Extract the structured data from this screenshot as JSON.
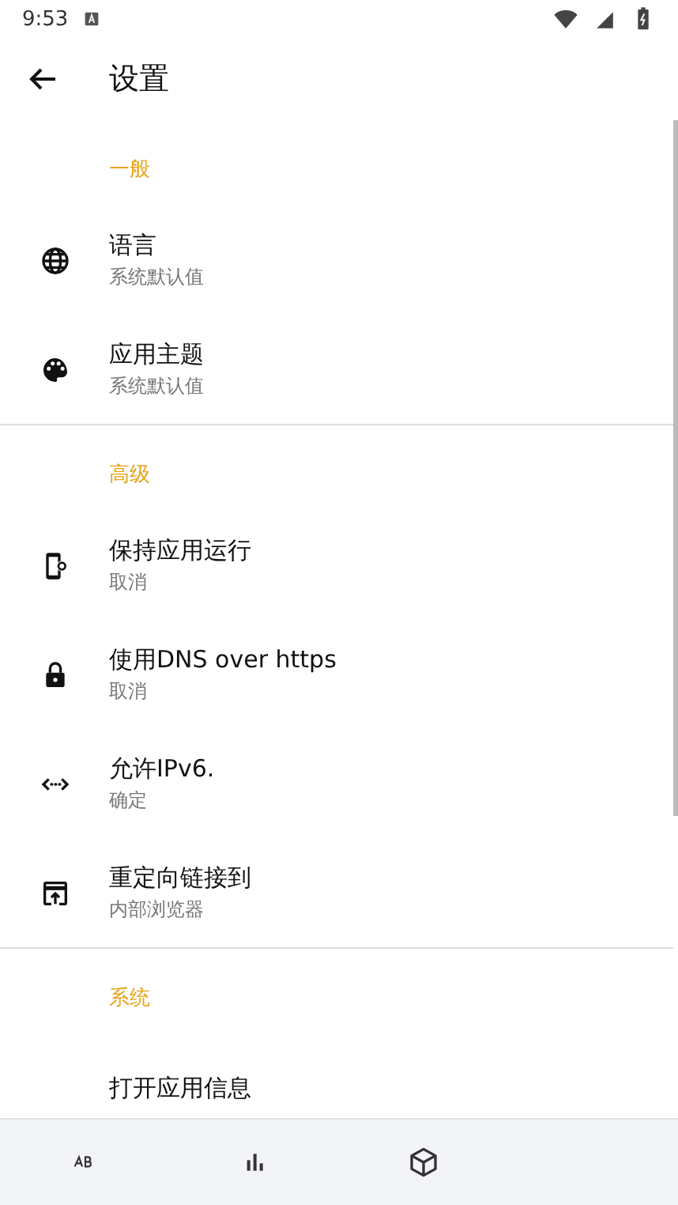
{
  "status_bar": {
    "time": "9:53"
  },
  "toolbar": {
    "title": "设置"
  },
  "sections": [
    {
      "header": "一般",
      "items": [
        {
          "title": "语言",
          "summary": "系统默认值"
        },
        {
          "title": "应用主题",
          "summary": "系统默认值"
        }
      ]
    },
    {
      "header": "高级",
      "items": [
        {
          "title": "保持应用运行",
          "summary": "取消"
        },
        {
          "title": "使用DNS over https",
          "summary": "取消"
        },
        {
          "title": "允许IPv6.",
          "summary": "确定"
        },
        {
          "title": "重定向链接到",
          "summary": "内部浏览器"
        }
      ]
    },
    {
      "header": "系统",
      "items": [
        {
          "title": "打开应用信息"
        }
      ]
    }
  ]
}
